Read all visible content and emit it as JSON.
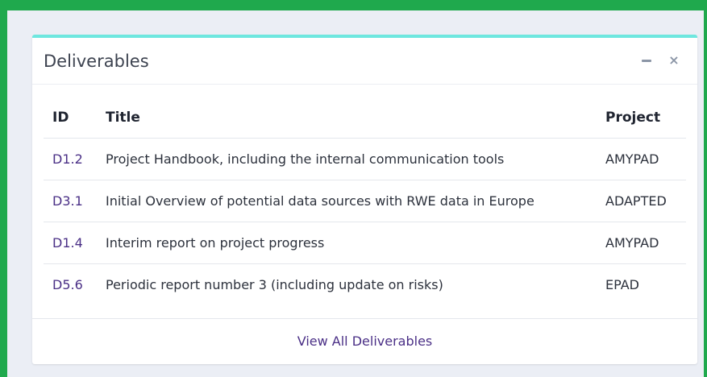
{
  "widget": {
    "title": "Deliverables",
    "minimize_icon": "minus-icon",
    "close_icon": "close-icon",
    "close_glyph": "×"
  },
  "table": {
    "columns": [
      "ID",
      "Title",
      "Project"
    ],
    "rows": [
      {
        "id": "D1.2",
        "title": "Project Handbook, including the internal communication tools",
        "project": "AMYPAD"
      },
      {
        "id": "D3.1",
        "title": "Initial Overview of potential data sources with RWE data in Europe",
        "project": "ADAPTED"
      },
      {
        "id": "D1.4",
        "title": "Interim report on project progress",
        "project": "AMYPAD"
      },
      {
        "id": "D5.6",
        "title": "Periodic report number 3 (including update on risks)",
        "project": "EPAD"
      }
    ]
  },
  "footer": {
    "view_all_label": "View All Deliverables"
  },
  "colors": {
    "frame_green": "#1fa94d",
    "accent_teal": "#6ee7df",
    "link_purple": "#4a2f86",
    "page_bg": "#ebeef5"
  }
}
